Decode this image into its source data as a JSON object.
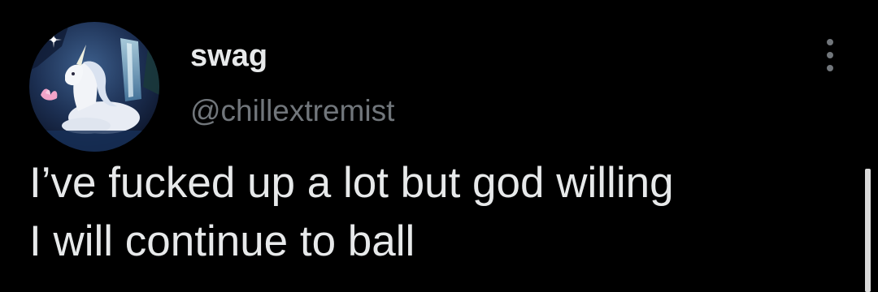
{
  "tweet": {
    "author": {
      "display_name": "swag",
      "handle": "@chillextremist",
      "avatar_icon": "unicorn-avatar-icon"
    },
    "text_lines": [
      "I’ve fucked up a lot but god willing",
      "I will continue to ball"
    ],
    "more_icon": "more-options-icon"
  },
  "colors": {
    "background": "#000000",
    "primary_text": "#e7e9ea",
    "secondary_text": "#71767b",
    "scrollbar": "#d9d9d9"
  }
}
